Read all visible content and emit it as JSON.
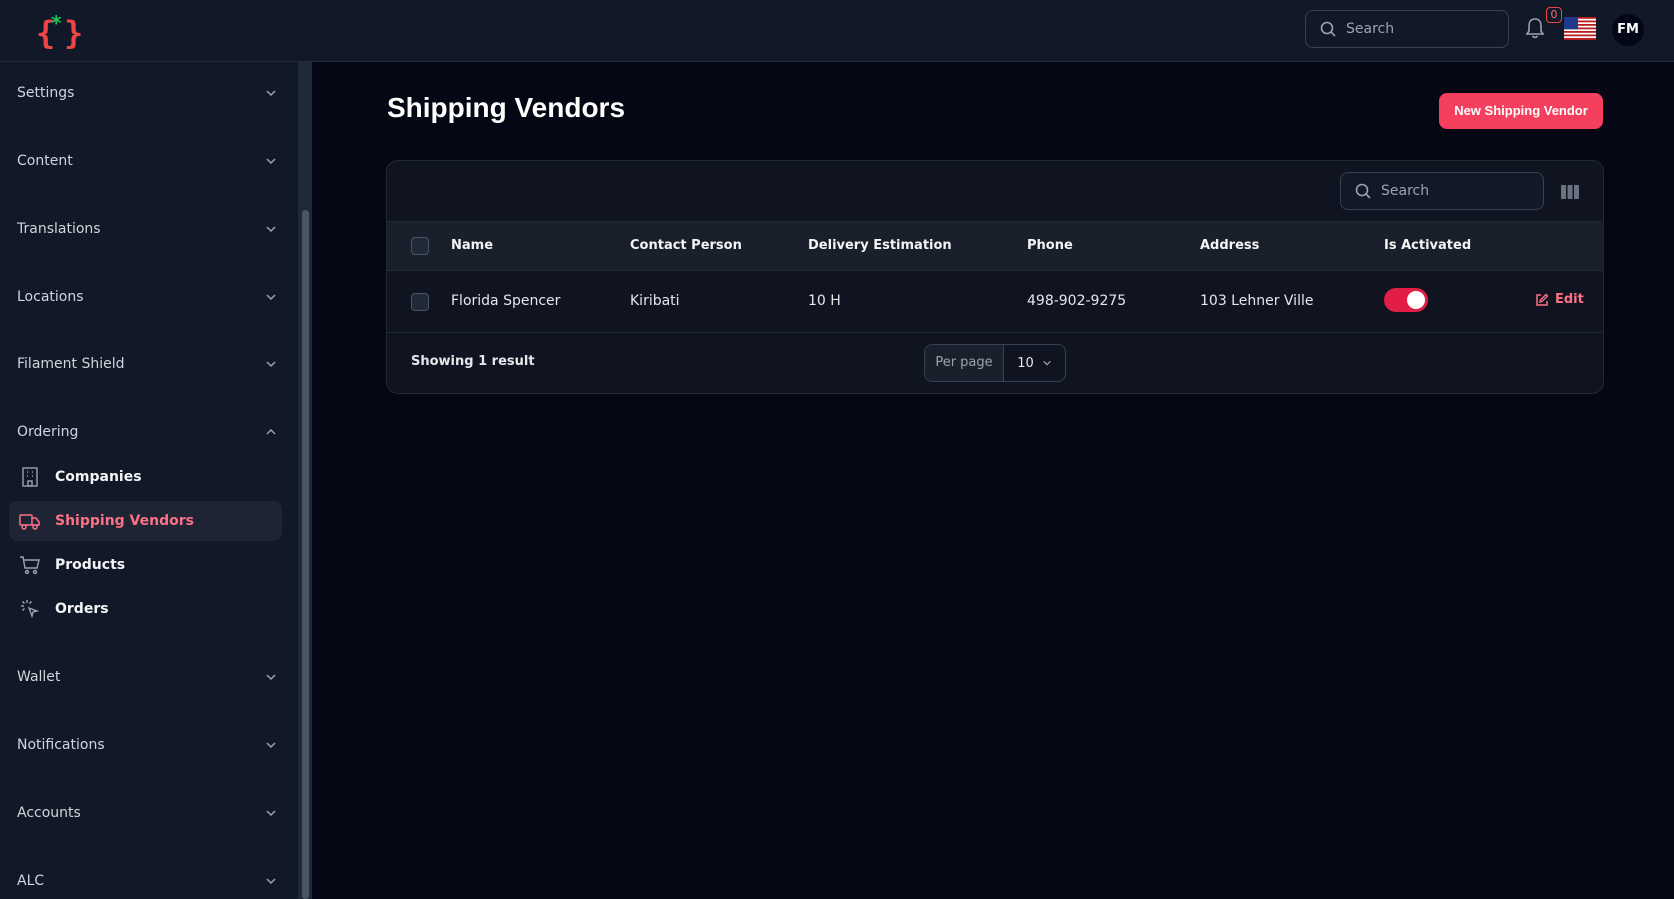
{
  "header": {
    "search_placeholder": "Search",
    "notification_count": "0",
    "avatar_initials": "FM",
    "flag": "us-flag-icon"
  },
  "sidebar": {
    "groups": [
      {
        "label": "Settings",
        "state": "collapsed"
      },
      {
        "label": "Content",
        "state": "collapsed"
      },
      {
        "label": "Translations",
        "state": "collapsed"
      },
      {
        "label": "Locations",
        "state": "collapsed"
      },
      {
        "label": "Filament Shield",
        "state": "collapsed"
      },
      {
        "label": "Ordering",
        "state": "expanded"
      },
      {
        "label": "Wallet",
        "state": "collapsed"
      },
      {
        "label": "Notifications",
        "state": "collapsed"
      },
      {
        "label": "Accounts",
        "state": "collapsed"
      },
      {
        "label": "ALC",
        "state": "collapsed"
      }
    ],
    "ordering_items": [
      {
        "label": "Companies",
        "icon": "building-icon",
        "active": false
      },
      {
        "label": "Shipping Vendors",
        "icon": "truck-icon",
        "active": true
      },
      {
        "label": "Products",
        "icon": "cart-icon",
        "active": false
      },
      {
        "label": "Orders",
        "icon": "cursor-click-icon",
        "active": false
      }
    ]
  },
  "main": {
    "title": "Shipping Vendors",
    "new_button": "New Shipping Vendor",
    "table_search_placeholder": "Search",
    "columns": [
      "Name",
      "Contact Person",
      "Delivery Estimation",
      "Phone",
      "Address",
      "Is Activated"
    ],
    "rows": [
      {
        "name": "Florida Spencer",
        "contact_person": "Kiribati",
        "delivery_estimation": "10 H",
        "phone": "498-902-9275",
        "address": "103 Lehner Ville",
        "is_activated": true,
        "action": "Edit"
      }
    ],
    "footer": {
      "showing": "Showing 1 result",
      "per_page_label": "Per page",
      "per_page_value": "10"
    }
  },
  "colors": {
    "accent": "#f43f5e",
    "background": "#050814",
    "surface": "#111827"
  }
}
